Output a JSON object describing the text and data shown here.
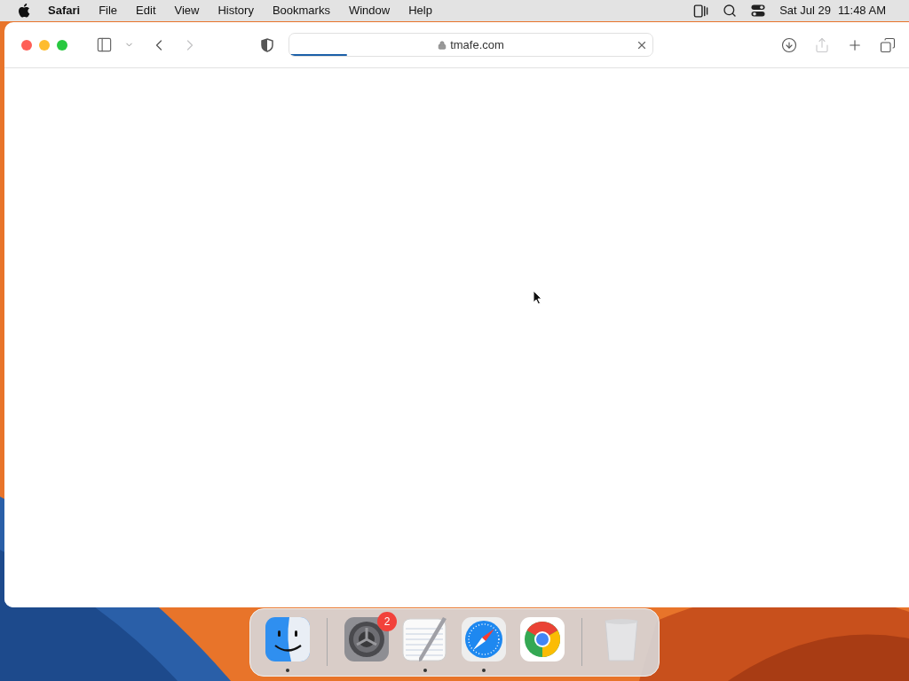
{
  "menu_bar": {
    "app": "Safari",
    "items": [
      "File",
      "Edit",
      "View",
      "History",
      "Bookmarks",
      "Window",
      "Help"
    ],
    "date": "Sat Jul 29",
    "time": "11:48 AM"
  },
  "toolbar": {
    "back": {
      "disabled": false
    },
    "forward": {
      "disabled": true
    },
    "address": "tmafe.com",
    "loading": {
      "level": 0.16
    },
    "share": {
      "disabled": true
    }
  },
  "dock": {
    "items": [
      {
        "kind": "finder",
        "running": true
      },
      {
        "kind": "separator"
      },
      {
        "kind": "settings",
        "running": false,
        "badge": "2"
      },
      {
        "kind": "textedit",
        "running": true
      },
      {
        "kind": "safari",
        "running": true
      },
      {
        "kind": "chrome",
        "running": false
      },
      {
        "kind": "separator"
      },
      {
        "kind": "trash",
        "running": false
      }
    ]
  }
}
